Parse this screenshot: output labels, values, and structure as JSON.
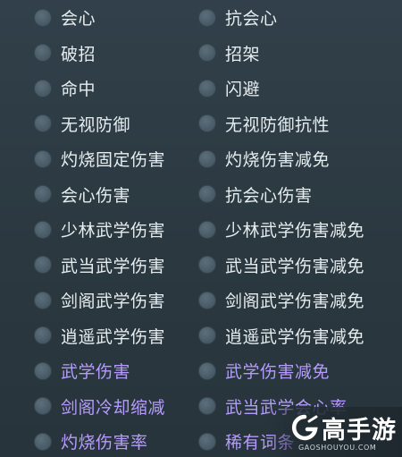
{
  "stats": {
    "left": [
      {
        "label": "会心",
        "color": "#e6edef"
      },
      {
        "label": "破招",
        "color": "#e6edef"
      },
      {
        "label": "命中",
        "color": "#e6edef"
      },
      {
        "label": "无视防御",
        "color": "#e6edef"
      },
      {
        "label": "灼烧固定伤害",
        "color": "#e6edef"
      },
      {
        "label": "会心伤害",
        "color": "#e6edef"
      },
      {
        "label": "少林武学伤害",
        "color": "#e6edef"
      },
      {
        "label": "武当武学伤害",
        "color": "#e6edef"
      },
      {
        "label": "剑阁武学伤害",
        "color": "#e6edef"
      },
      {
        "label": "逍遥武学伤害",
        "color": "#e6edef"
      },
      {
        "label": "武学伤害",
        "color": "#b69bff"
      },
      {
        "label": "剑阁冷却缩减",
        "color": "#b69bff"
      },
      {
        "label": "灼烧伤害率",
        "color": "#b69bff"
      }
    ],
    "right": [
      {
        "label": "抗会心",
        "color": "#e6edef"
      },
      {
        "label": "招架",
        "color": "#e6edef"
      },
      {
        "label": "闪避",
        "color": "#e6edef"
      },
      {
        "label": "无视防御抗性",
        "color": "#e6edef"
      },
      {
        "label": "灼烧伤害减免",
        "color": "#e6edef"
      },
      {
        "label": "抗会心伤害",
        "color": "#e6edef"
      },
      {
        "label": "少林武学伤害减免",
        "color": "#e6edef"
      },
      {
        "label": "武当武学伤害减免",
        "color": "#e6edef"
      },
      {
        "label": "剑阁武学伤害减免",
        "color": "#e6edef"
      },
      {
        "label": "逍遥武学伤害减免",
        "color": "#e6edef"
      },
      {
        "label": "武学伤害减免",
        "color": "#b69bff"
      },
      {
        "label": "武当武学会心率",
        "color": "#b69bff"
      },
      {
        "label": "稀有词条",
        "color": "#b69bff"
      }
    ]
  },
  "watermark": {
    "brand": "高手游",
    "url": "GAOSHOUYOU.COM"
  }
}
